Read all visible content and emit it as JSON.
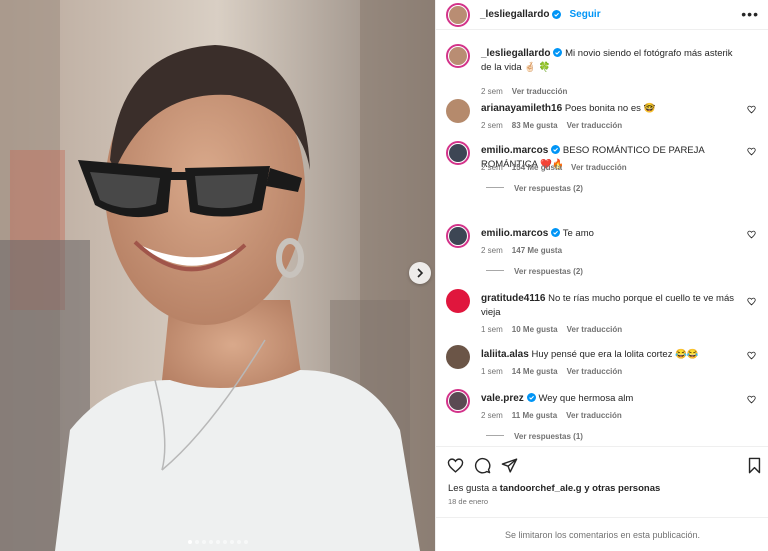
{
  "post": {
    "author": "_lesliegallardo",
    "follow_label": "Seguir",
    "more_label": "•••",
    "caption": "Mi novio siendo el fotógrafo más asterik de la vida 🤞🏻 🍀",
    "caption_age": "2 sem",
    "caption_translate": "Ver traducción",
    "carousel_dots": 9
  },
  "comments": [
    {
      "user": "arianayamileth16",
      "verified": false,
      "text": "Poes bonita no es 🤓",
      "age": "2 sem",
      "likes": "83 Me gusta",
      "action": "Ver traducción",
      "replies": "",
      "avatar_color": "#b58a6c",
      "ring": false
    },
    {
      "user": "emilio.marcos",
      "verified": true,
      "text": "BESO ROMÁNTICO DE PAREJA ROMÁNTICA ❤️🔥",
      "age": "2 sem",
      "likes": "154 Me gusta",
      "action": "Ver traducción",
      "replies": "Ver respuestas (2)",
      "avatar_color": "#3d4654",
      "ring": true
    },
    {
      "user": "emilio.marcos",
      "verified": true,
      "text": "Te amo",
      "age": "2 sem",
      "likes": "147 Me gusta",
      "action": "",
      "replies": "Ver respuestas (2)",
      "avatar_color": "#3d4654",
      "ring": true
    },
    {
      "user": "gratitude4116",
      "verified": false,
      "text": "No te rías mucho porque el cuello te ve más vieja",
      "age": "1 sem",
      "likes": "10 Me gusta",
      "action": "Ver traducción",
      "replies": "",
      "avatar_color": "#e0163d",
      "ring": false
    },
    {
      "user": "laliita.alas",
      "verified": false,
      "text": "Huy pensé que era la lolita cortez 😂😂",
      "age": "1 sem",
      "likes": "14 Me gusta",
      "action": "Ver traducción",
      "replies": "",
      "avatar_color": "#6b5547",
      "ring": false
    },
    {
      "user": "vale.prez",
      "verified": true,
      "text": "Wey que hermosa alm",
      "age": "2 sem",
      "likes": "11 Me gusta",
      "action": "Ver traducción",
      "replies": "Ver respuestas (1)",
      "avatar_color": "#5a4a53",
      "ring": true
    }
  ],
  "footer": {
    "likes_prefix": "Les gusta a ",
    "likes_user": "tandoorchef_ale.g",
    "likes_suffix": " y otras personas",
    "date": "18 de enero",
    "comments_limited": "Se limitaron los comentarios en esta publicación."
  },
  "icons": {
    "verified": "verified-badge-icon",
    "heart": "heart-icon",
    "comment": "comment-icon",
    "share": "share-icon",
    "save": "bookmark-icon",
    "next": "chevron-right-icon"
  },
  "colors": {
    "accent": "#0095f6",
    "ring": "#d3338a",
    "verified": "#0095f6"
  }
}
